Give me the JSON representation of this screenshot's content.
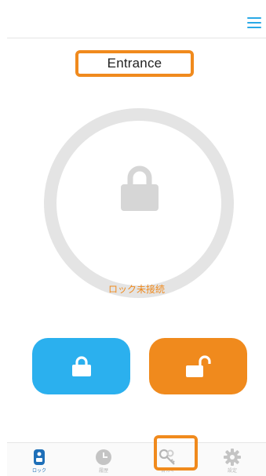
{
  "header": {
    "menu_icon": "hamburger-menu-icon",
    "accent": "#2aa9e6"
  },
  "device": {
    "name": "Entrance",
    "status": "ロック未接続",
    "ring_icon": "padlock-closed-icon"
  },
  "actions": {
    "lock": {
      "icon": "padlock-closed-icon",
      "color": "#2bb0ee"
    },
    "unlock": {
      "icon": "padlock-open-icon",
      "color": "#f08a1d"
    }
  },
  "tabs": [
    {
      "label": "ロック",
      "icon": "lock-device-icon",
      "active": true
    },
    {
      "label": "履歴",
      "icon": "clock-icon",
      "active": false
    },
    {
      "label": "合カギ",
      "icon": "keys-icon",
      "active": false
    },
    {
      "label": "設定",
      "icon": "gear-icon",
      "active": false
    }
  ],
  "colors": {
    "highlight": "#f08a1d",
    "ring": "#e4e4e4",
    "active_tab": "#1e6fb8"
  }
}
